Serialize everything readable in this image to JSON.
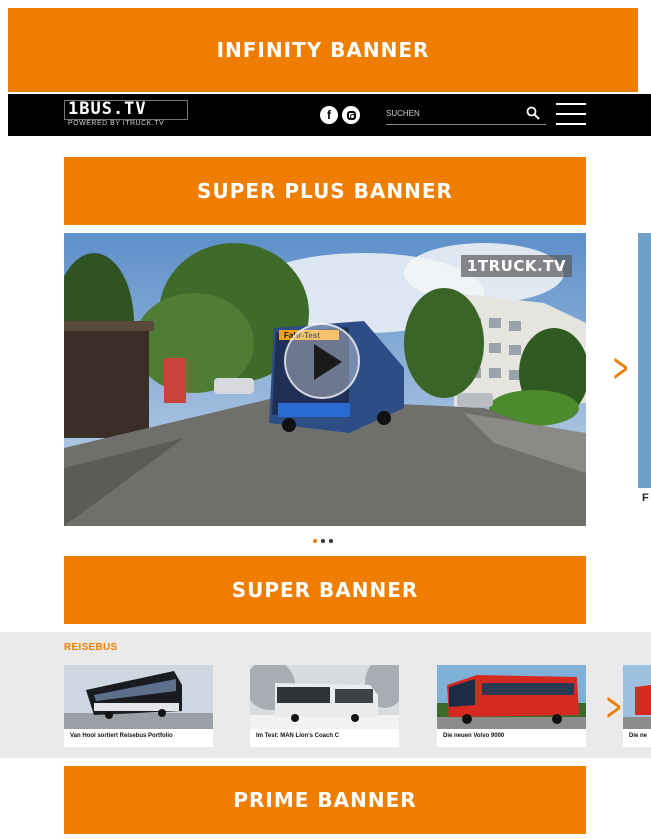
{
  "banners": {
    "infinity": "INFINITY BANNER",
    "super_plus": "SUPER PLUS BANNER",
    "super": "SUPER BANNER",
    "prime": "PRIME BANNER"
  },
  "nav": {
    "logo": "1BUS.TV",
    "logo_tagline": "POWERED BY ITRUCK.TV",
    "search_placeholder": "SUCHEN",
    "social": [
      "facebook-icon",
      "instagram-icon"
    ]
  },
  "hero": {
    "watermark": "1TRUCK.TV",
    "bus_destination": "Fahr-Test",
    "next_card_caption": "F",
    "slider_dots": 3,
    "active_dot": 0
  },
  "reisebus": {
    "title": "REISEBUS",
    "cards": [
      {
        "caption": "Van Hool sortiert Reisebus Portfolio"
      },
      {
        "caption": "Im Test: MAN Lion's Coach C"
      },
      {
        "caption": "Die neuen Volvo 9000"
      },
      {
        "caption": "Die ne"
      }
    ]
  },
  "colors": {
    "accent": "#ef7d00",
    "navbar": "#000000",
    "strip_bg": "#eaeaea"
  }
}
